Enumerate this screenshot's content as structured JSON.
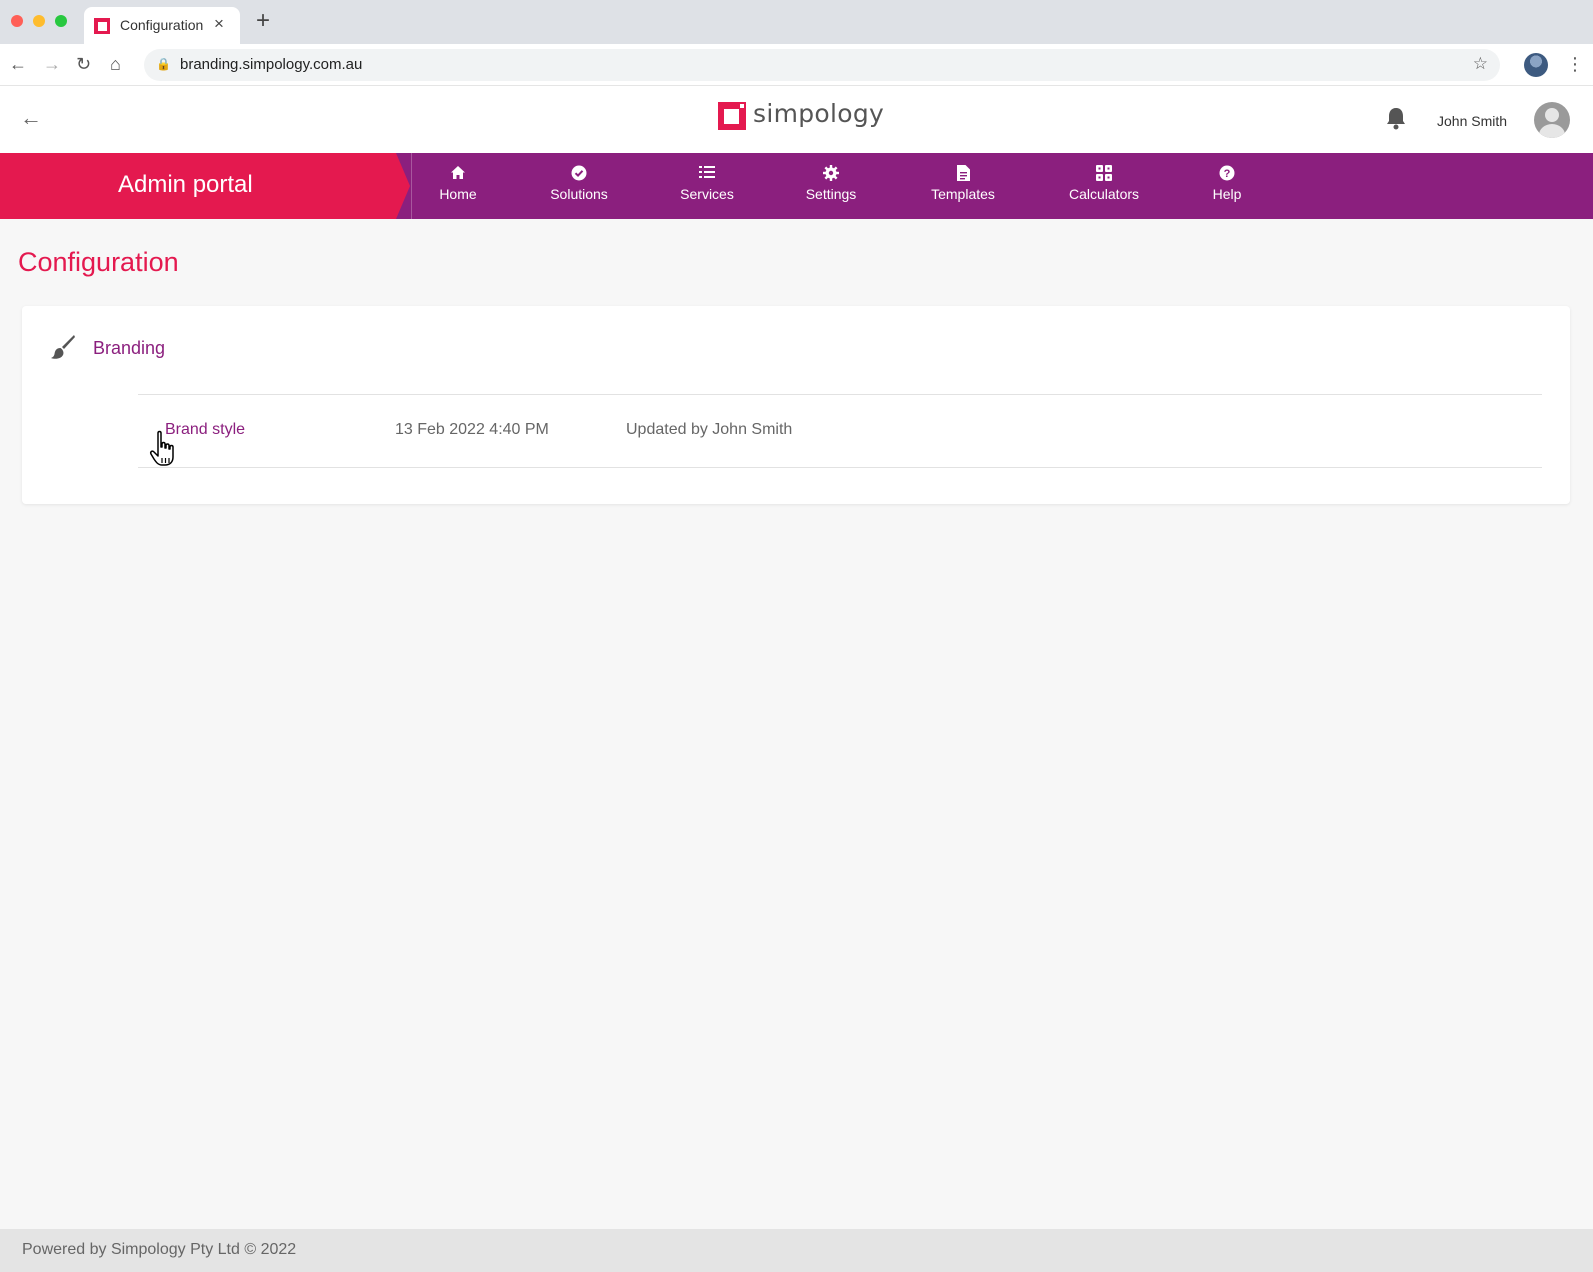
{
  "browser": {
    "tab_title": "Configuration",
    "tab_close": "×",
    "new_tab": "+",
    "url": "branding.simpology.com.au",
    "icons": [
      "back-icon",
      "forward-icon",
      "reload-icon",
      "home-icon",
      "lock-icon",
      "star-icon",
      "profile-avatar",
      "menu-icon"
    ]
  },
  "header": {
    "logo_text": "simpology",
    "user_name": "John Smith"
  },
  "navbar": {
    "portal_title": "Admin portal",
    "items": [
      {
        "label": "Home",
        "icon": "⌂"
      },
      {
        "label": "Solutions",
        "icon": "✔"
      },
      {
        "label": "Services",
        "icon": "☰"
      },
      {
        "label": "Settings",
        "icon": "⚙"
      },
      {
        "label": "Templates",
        "icon": "▤"
      },
      {
        "label": "Calculators",
        "icon": "▦"
      },
      {
        "label": "Help",
        "icon": "?"
      }
    ]
  },
  "main": {
    "page_title": "Configuration",
    "section": {
      "title": "Branding",
      "rows": [
        {
          "name": "Brand style",
          "date": "13 Feb 2022 4:40 PM",
          "updated": "Updated by John Smith"
        }
      ]
    }
  },
  "footer": {
    "text": "Powered by Simpology Pty Ltd © 2022"
  },
  "colors": {
    "brand_pink": "#e4194f",
    "brand_purple": "#8b1f7e"
  }
}
